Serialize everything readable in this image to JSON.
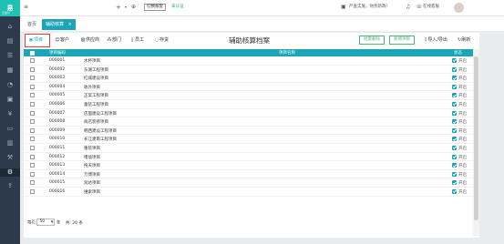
{
  "sidebar": {
    "logo": "易",
    "logo_sub": "云会计",
    "items": [
      {
        "name": "home-icon",
        "glyph": "⌂"
      },
      {
        "name": "voucher-icon",
        "glyph": "▤"
      },
      {
        "name": "ledger-icon",
        "glyph": "☰"
      },
      {
        "name": "report-icon",
        "glyph": "▦"
      },
      {
        "name": "chart-icon",
        "glyph": "◔"
      },
      {
        "name": "asset-icon",
        "glyph": "▣"
      },
      {
        "name": "cash-icon",
        "glyph": "¥"
      },
      {
        "name": "invoice-icon",
        "glyph": "▭"
      },
      {
        "name": "archive-icon",
        "glyph": "▥"
      },
      {
        "name": "tool-icon",
        "glyph": "⚒"
      },
      {
        "name": "settings-icon",
        "glyph": "⚙"
      },
      {
        "name": "export-icon",
        "glyph": "⇪"
      }
    ]
  },
  "topbar": {
    "menu_glyph": "≡",
    "add_glyph": "+",
    "switch_label": "切换账套",
    "cert_label": "未认证",
    "bulletin": "严查实施，财务新政!",
    "service": "在线客服"
  },
  "tabs": {
    "home": "首页",
    "active": "辅助核算",
    "close": "×"
  },
  "toolbar": {
    "title": "辅助核算档案",
    "items": [
      {
        "label": "项目",
        "icon": "◉"
      },
      {
        "label": "客户",
        "icon": "☺"
      },
      {
        "label": "供应商",
        "icon": "▧"
      },
      {
        "label": "部门",
        "icon": "⁂"
      },
      {
        "label": "员工",
        "icon": "▯"
      },
      {
        "label": "存货",
        "icon": "◌"
      }
    ],
    "batch_delete": "批量删除",
    "new_project": "新增项目",
    "import_export": "导入/导出",
    "refresh": "刷新"
  },
  "table": {
    "columns": [
      "项目编码",
      "项目名称",
      "状态"
    ],
    "rows": [
      {
        "code": "000001",
        "name": "水杯项目",
        "status": "开启"
      },
      {
        "code": "000002",
        "name": "东湖工程项目",
        "status": "开启"
      },
      {
        "code": "000003",
        "name": "红城建设项目",
        "status": "开启"
      },
      {
        "code": "000004",
        "name": "收外项目",
        "status": "开启"
      },
      {
        "code": "000005",
        "name": "正案工程项目",
        "status": "开启"
      },
      {
        "code": "000006",
        "name": "童装工程项目",
        "status": "开启"
      },
      {
        "code": "000007",
        "name": "店面建设工程项目",
        "status": "开启"
      },
      {
        "code": "000008",
        "name": "商店装修项目",
        "status": "开启"
      },
      {
        "code": "000009",
        "name": "韩西建设工程项目",
        "status": "开启"
      },
      {
        "code": "000010",
        "name": "长江建南工程项目",
        "status": "开启"
      },
      {
        "code": "000011",
        "name": "重装项目",
        "status": "开启"
      },
      {
        "code": "000012",
        "name": "堵墙项目",
        "status": "开启"
      },
      {
        "code": "000013",
        "name": "拖天项目",
        "status": "开启"
      },
      {
        "code": "000014",
        "name": "万博项目",
        "status": "开启"
      },
      {
        "code": "000015",
        "name": "润达项目",
        "status": "开启"
      },
      {
        "code": "000016",
        "name": "维索项目",
        "status": "开启"
      }
    ]
  },
  "pagination": {
    "per_page_label": "每页",
    "per_page_value": "50",
    "unit": "条",
    "total": "共: 20 条"
  },
  "colors": {
    "accent": "#1aa5b8",
    "sidebar": "#2d3a4b",
    "highlight_frame": "#e53b3b",
    "button_green": "#4bb878"
  }
}
